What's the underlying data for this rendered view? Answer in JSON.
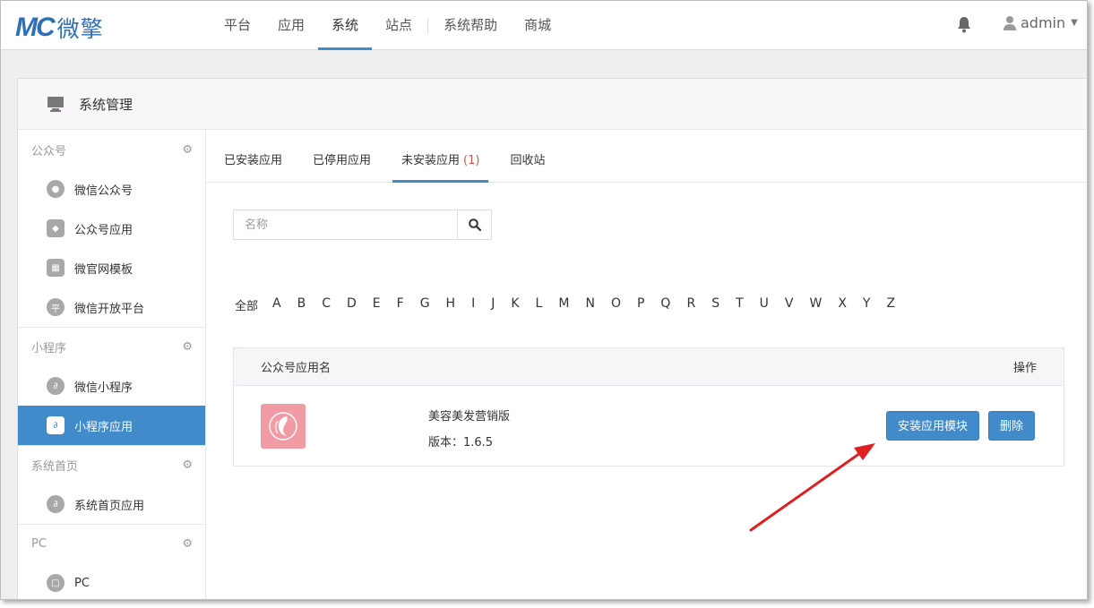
{
  "brand": {
    "logo_mark": "MC",
    "logo_text": "微擎",
    "color": "#2e6fb7"
  },
  "nav": {
    "items": [
      "平台",
      "应用",
      "系统",
      "站点",
      "系统帮助",
      "商城"
    ],
    "active": "系统"
  },
  "user": {
    "name": "admin"
  },
  "panel": {
    "title": "系统管理"
  },
  "sidebar": {
    "sections": [
      {
        "title": "公众号",
        "items": [
          "微信公众号",
          "公众号应用",
          "微官网模板",
          "微信开放平台"
        ]
      },
      {
        "title": "小程序",
        "items": [
          "微信小程序",
          "小程序应用"
        ]
      },
      {
        "title": "系统首页",
        "items": [
          "系统首页应用"
        ]
      },
      {
        "title": "PC",
        "items": [
          "PC"
        ]
      }
    ],
    "active_item": "小程序应用"
  },
  "tabs": {
    "installed": "已安装应用",
    "disabled": "已停用应用",
    "uninstalled": "未安装应用",
    "uninstalled_count": "(1)",
    "recycle": "回收站"
  },
  "search": {
    "placeholder": "名称"
  },
  "alphabet": [
    "全部",
    "A",
    "B",
    "C",
    "D",
    "E",
    "F",
    "G",
    "H",
    "I",
    "J",
    "K",
    "L",
    "M",
    "N",
    "O",
    "P",
    "Q",
    "R",
    "S",
    "T",
    "U",
    "V",
    "W",
    "X",
    "Y",
    "Z"
  ],
  "table": {
    "col_name": "公众号应用名",
    "col_action": "操作",
    "rows": [
      {
        "name": "美容美发营销版",
        "version": "版本：1.6.5",
        "install_label": "安装应用模块",
        "delete_label": "删除"
      }
    ]
  },
  "colors": {
    "accent": "#428bca",
    "arrow": "#e02020",
    "app_icon": "#f19ca5"
  }
}
